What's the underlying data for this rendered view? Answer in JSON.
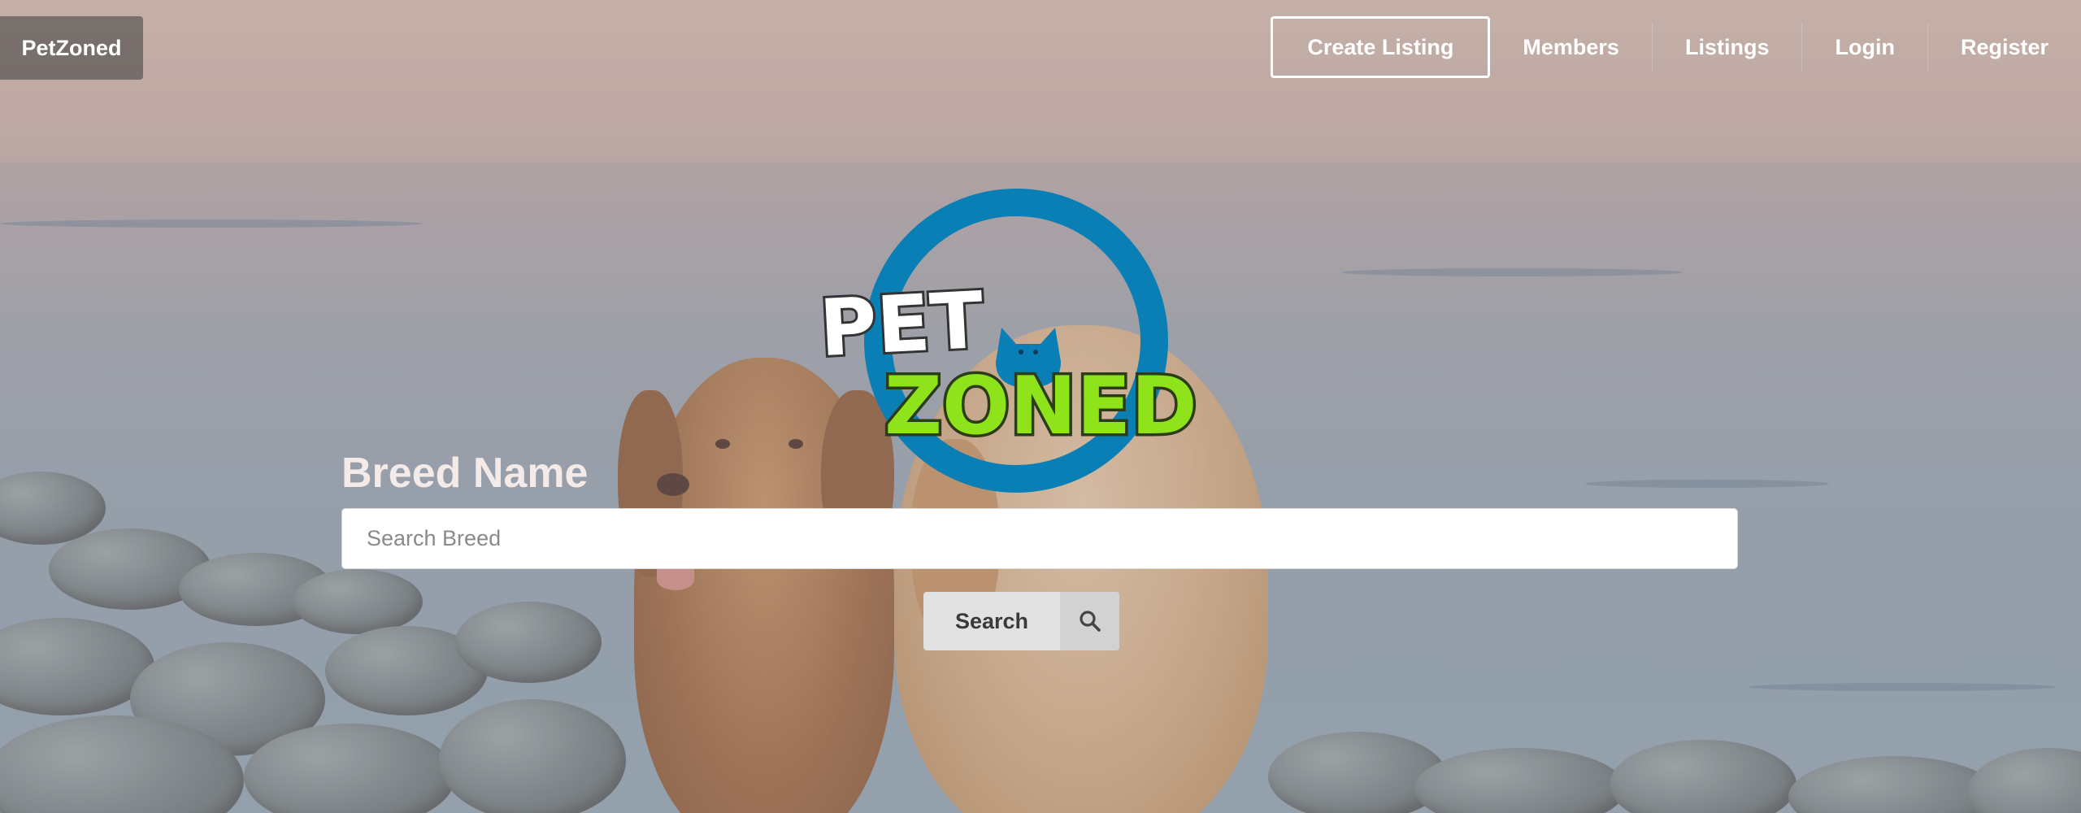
{
  "brand": {
    "name": "PetZoned"
  },
  "nav": {
    "items": [
      {
        "label": "Create Listing"
      },
      {
        "label": "Members"
      },
      {
        "label": "Listings"
      },
      {
        "label": "Login"
      },
      {
        "label": "Register"
      }
    ]
  },
  "logo": {
    "line1": "PET",
    "line2": "ZONED"
  },
  "search": {
    "label": "Breed Name",
    "placeholder": "Search Breed",
    "value": "",
    "button_label": "Search",
    "button_icon": "search-icon"
  },
  "colors": {
    "logo_ring": "#0a7fb5",
    "logo_green": "#8ee31a",
    "nav_text": "#ffffff",
    "button_bg": "#e2e2e2"
  }
}
